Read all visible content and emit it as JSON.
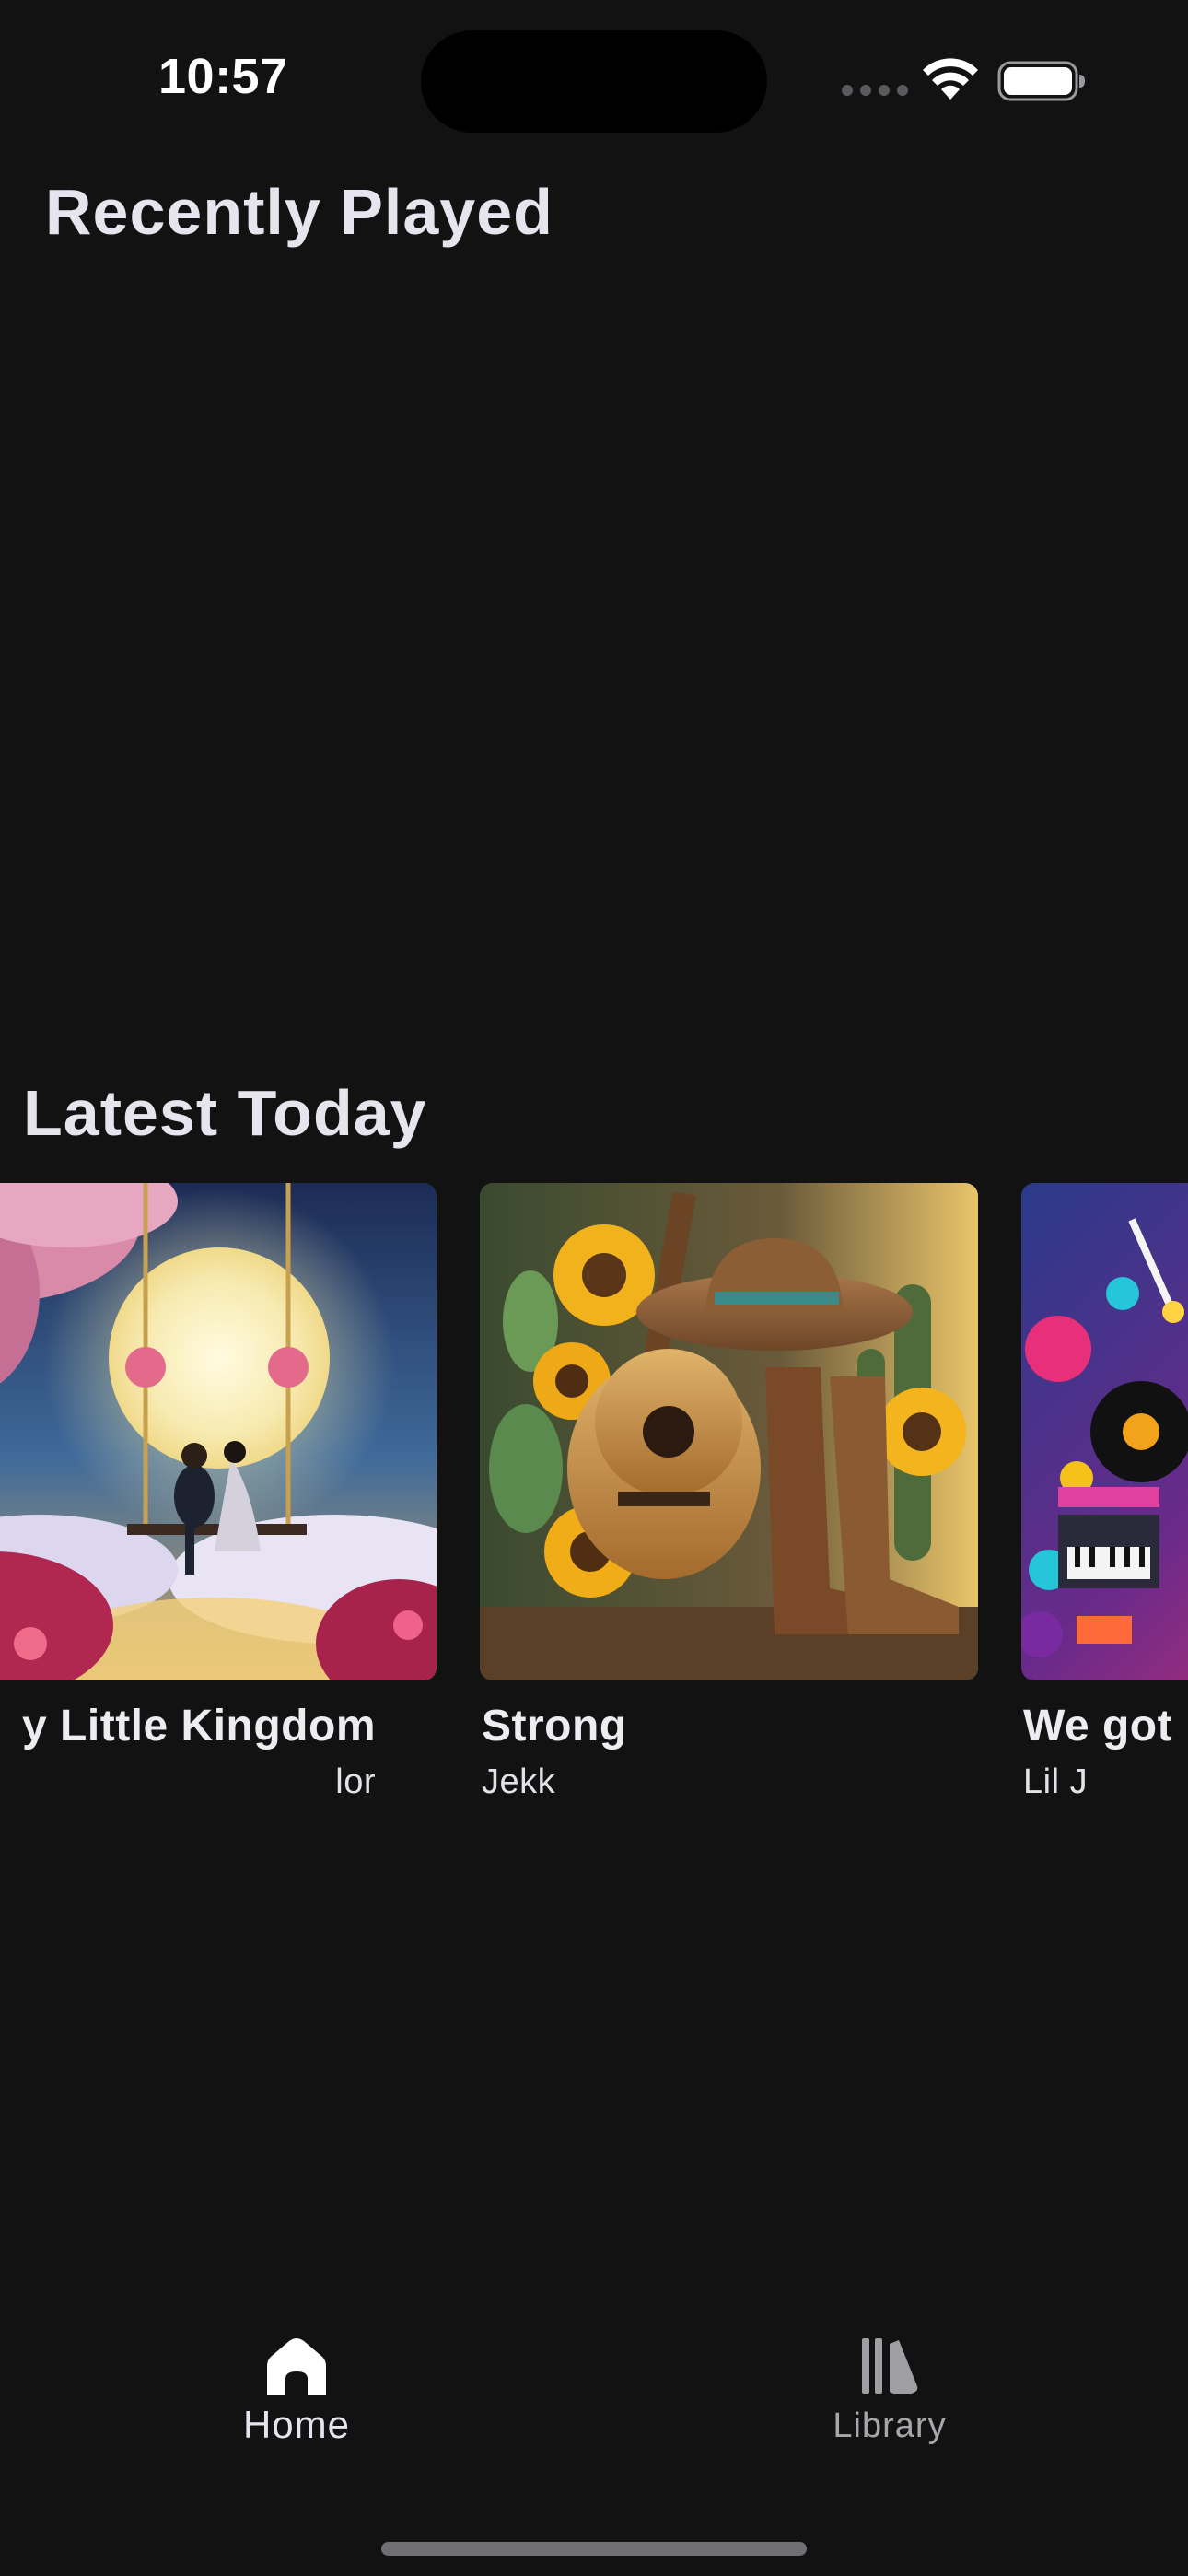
{
  "status_bar": {
    "time": "10:57",
    "signal_icon": "cellular-signal-icon",
    "wifi_icon": "wifi-icon",
    "battery_icon": "battery-full-icon"
  },
  "recently_played": {
    "title": "Recently Played"
  },
  "latest_today": {
    "title": "Latest Today",
    "albums": [
      {
        "title": "y Little Kingdom",
        "artist": "lor",
        "art": "moonlit-swing-couple-artwork"
      },
      {
        "title": "Strong",
        "artist": "Jekk",
        "art": "cowboy-hat-guitar-sunflowers-artwork"
      },
      {
        "title": "We got",
        "artist": "Lil J",
        "art": "colorful-vinyl-synth-artwork"
      }
    ]
  },
  "tab_bar": {
    "tabs": [
      {
        "label": "Home",
        "icon": "home-icon",
        "selected": true
      },
      {
        "label": "Library",
        "icon": "library-icon",
        "selected": false
      }
    ]
  },
  "colors": {
    "background": "#121212",
    "text_primary": "#ececf1",
    "tab_inactive": "#a6a6ab"
  }
}
